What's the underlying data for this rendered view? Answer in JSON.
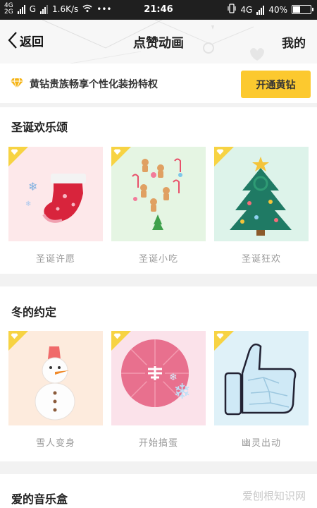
{
  "status_bar": {
    "net_top": "4G",
    "net_bottom": "2G",
    "carrier": "G",
    "speed": "1.6K/s",
    "dots": "•••",
    "time": "21:46",
    "net_right": "4G",
    "battery": "40%",
    "battery_level": 0.4
  },
  "nav": {
    "back_label": "返回",
    "title": "点赞动画",
    "right_label": "我的"
  },
  "promo": {
    "text": "黄钻贵族畅享个性化装扮特权",
    "button": "开通黄钻"
  },
  "sections": [
    {
      "title": "圣诞欢乐颂",
      "items": [
        {
          "label": "圣诞许愿",
          "icon": "stocking-icon",
          "bg": "#fde8ea"
        },
        {
          "label": "圣诞小吃",
          "icon": "gingerbread-icon",
          "bg": "#e5f5e3"
        },
        {
          "label": "圣诞狂欢",
          "icon": "christmas-tree-icon",
          "bg": "#ddf3ea"
        }
      ]
    },
    {
      "title": "冬的约定",
      "items": [
        {
          "label": "雪人变身",
          "icon": "snowman-icon",
          "bg": "#fdebdd"
        },
        {
          "label": "开始搞蛋",
          "icon": "umbrella-icon",
          "bg": "#fbe2ea"
        },
        {
          "label": "幽灵出动",
          "icon": "ice-thumb-icon",
          "bg": "#dff1f8"
        }
      ]
    },
    {
      "title": "爱的音乐盒"
    }
  ],
  "badge_color": "#f7d343",
  "accent_color": "#fcc92f",
  "watermark": "爱刨根知识网"
}
